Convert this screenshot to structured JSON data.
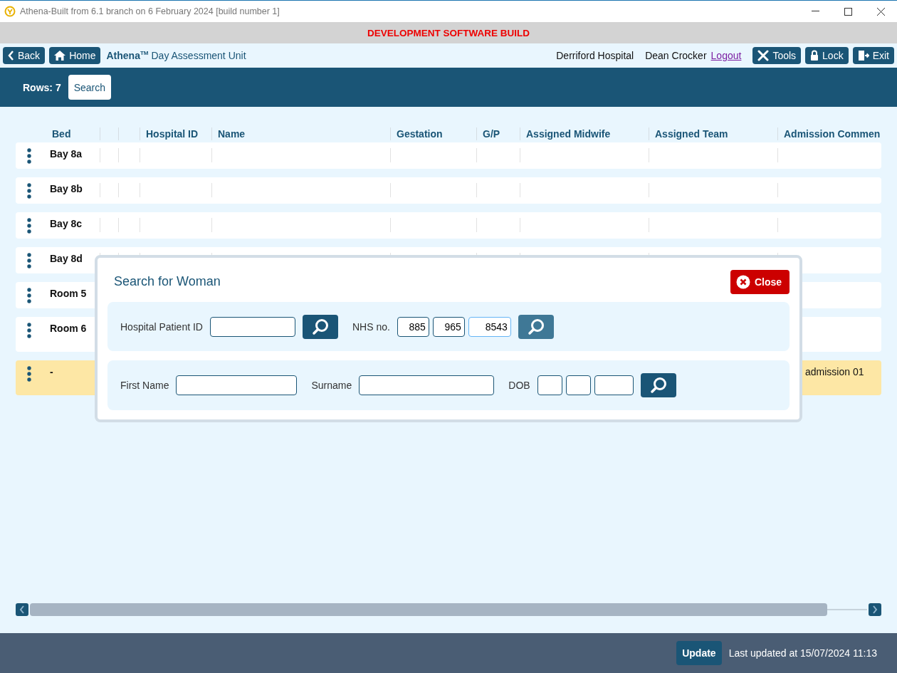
{
  "window": {
    "title": "Athena-Built from 6.1 branch on 6 February 2024 [build number 1]"
  },
  "banner": "DEVELOPMENT SOFTWARE BUILD",
  "nav": {
    "back": "Back",
    "home": "Home",
    "brand": "Athena",
    "brand_mark": "TM",
    "unit": "Day Assessment Unit",
    "hospital": "Derriford Hospital",
    "user": "Dean Crocker",
    "logout": "Logout",
    "buttons": [
      "Tools",
      "Lock",
      "Exit"
    ]
  },
  "toolbar": {
    "rows": "Rows: 7",
    "search": "Search"
  },
  "table": {
    "columns": [
      "Bed",
      "",
      "",
      "Hospital ID",
      "Name",
      "Gestation",
      "G/P",
      "Assigned Midwife",
      "Assigned Team",
      "Admission Commen"
    ],
    "rows": [
      {
        "bed": "Bay 8a",
        "highlighted": false
      },
      {
        "bed": "Bay 8b",
        "highlighted": false
      },
      {
        "bed": "Bay 8c",
        "highlighted": false
      },
      {
        "bed": "Bay 8d",
        "highlighted": false
      },
      {
        "bed": "Room 5",
        "highlighted": false
      },
      {
        "bed": "Room 6",
        "highlighted": false
      },
      {
        "bed": "-",
        "highlighted": true,
        "admission_comment": "admission 01"
      }
    ]
  },
  "dialog": {
    "title": "Search for Woman",
    "close": "Close",
    "hospital_id": {
      "label": "Hospital Patient ID"
    },
    "nhs": {
      "label": "NHS no.",
      "parts": [
        {
          "value": "885",
          "focused": false
        },
        {
          "value": "965",
          "focused": false
        },
        {
          "value": "8543",
          "focused": true
        }
      ]
    },
    "hospital_search_hover": false,
    "nhs_search_hover": true,
    "name_search_hover": false,
    "first_name": {
      "label": "First Name"
    },
    "surname": {
      "label": "Surname"
    },
    "dob": {
      "label": "DOB"
    }
  },
  "footer": {
    "update": "Update",
    "last_updated": "Last updated at 15/07/2024 11:13"
  }
}
